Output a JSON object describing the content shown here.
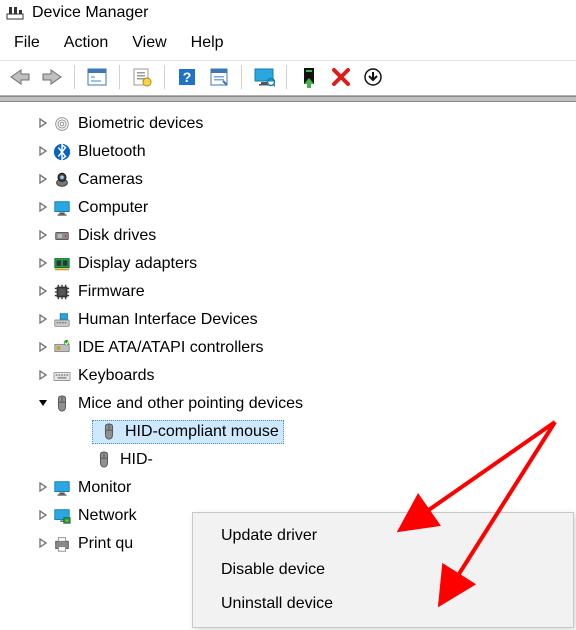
{
  "window": {
    "title": "Device Manager"
  },
  "menu": {
    "file": "File",
    "action": "Action",
    "view": "View",
    "help": "Help"
  },
  "toolbar": {
    "back": "back",
    "forward": "forward",
    "show_hidden": "show-hidden",
    "properties": "properties",
    "help": "help",
    "scan": "scan",
    "monitor": "monitor",
    "update": "update",
    "remove": "remove",
    "more": "more"
  },
  "tree": {
    "items": [
      {
        "label": "Biometric devices",
        "icon": "fingerprint",
        "expanded": false,
        "indent": 1
      },
      {
        "label": "Bluetooth",
        "icon": "bluetooth",
        "expanded": false,
        "indent": 1
      },
      {
        "label": "Cameras",
        "icon": "camera",
        "expanded": false,
        "indent": 1
      },
      {
        "label": "Computer",
        "icon": "computer",
        "expanded": false,
        "indent": 1
      },
      {
        "label": "Disk drives",
        "icon": "disk",
        "expanded": false,
        "indent": 1
      },
      {
        "label": "Display adapters",
        "icon": "display-adapter",
        "expanded": false,
        "indent": 1
      },
      {
        "label": "Firmware",
        "icon": "firmware",
        "expanded": false,
        "indent": 1
      },
      {
        "label": "Human Interface Devices",
        "icon": "hid",
        "expanded": false,
        "indent": 1
      },
      {
        "label": "IDE ATA/ATAPI controllers",
        "icon": "ide",
        "expanded": false,
        "indent": 1
      },
      {
        "label": "Keyboards",
        "icon": "keyboard",
        "expanded": false,
        "indent": 1
      },
      {
        "label": "Mice and other pointing devices",
        "icon": "mouse",
        "expanded": true,
        "indent": 1
      },
      {
        "label": "HID-compliant mouse",
        "icon": "mouse",
        "expanded": null,
        "indent": 2,
        "selected": true
      },
      {
        "label": "HID-",
        "icon": "mouse",
        "expanded": null,
        "indent": 2,
        "truncated": true
      },
      {
        "label": "Monitor",
        "icon": "monitor",
        "expanded": false,
        "indent": 1,
        "truncated": true
      },
      {
        "label": "Network",
        "icon": "network",
        "expanded": false,
        "indent": 1,
        "truncated": true
      },
      {
        "label": "Print qu",
        "icon": "printer",
        "expanded": false,
        "indent": 1,
        "truncated": true
      }
    ]
  },
  "context_menu": {
    "items": [
      {
        "label": "Update driver"
      },
      {
        "label": "Disable device"
      },
      {
        "label": "Uninstall device"
      }
    ]
  }
}
